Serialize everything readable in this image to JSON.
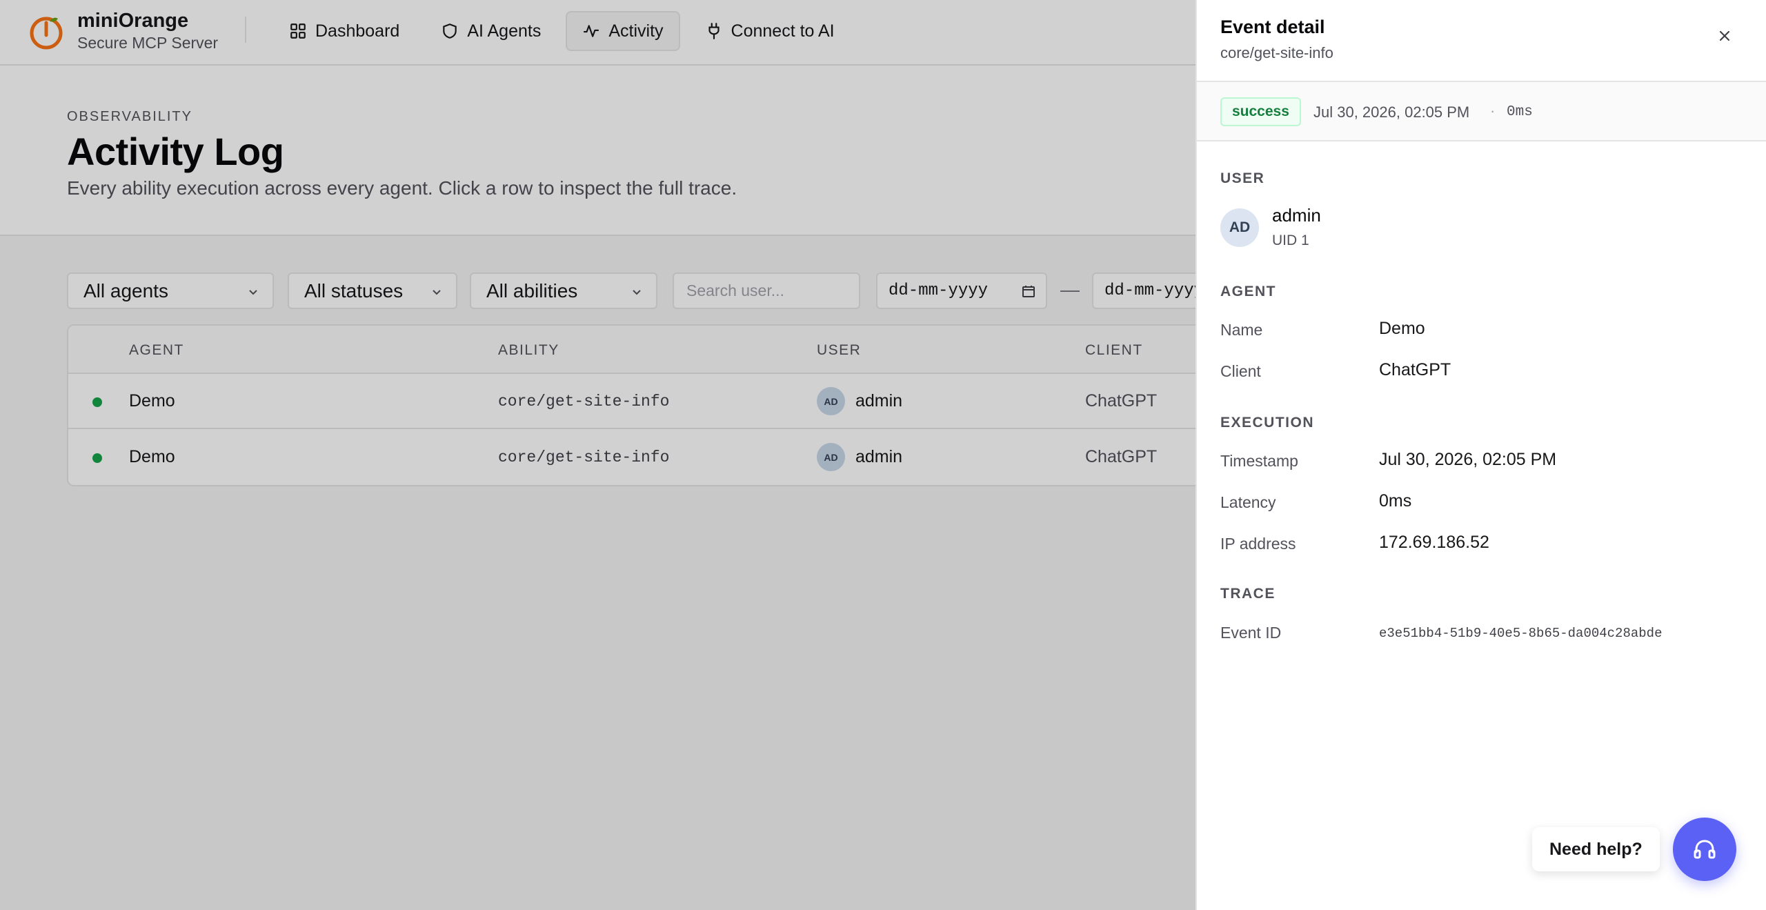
{
  "brand": {
    "name": "miniOrange",
    "subtitle": "Secure MCP Server"
  },
  "nav": {
    "dashboard": "Dashboard",
    "agents": "AI Agents",
    "activity": "Activity",
    "connect": "Connect to AI"
  },
  "header": {
    "eyebrow": "OBSERVABILITY",
    "title": "Activity Log",
    "description": "Every ability execution across every agent. Click a row to inspect the full trace."
  },
  "filters": {
    "agents": "All agents",
    "statuses": "All statuses",
    "abilities": "All abilities",
    "search_placeholder": "Search user...",
    "date_from": "dd-mm-yyyy",
    "separator": "—",
    "date_to": "dd-mm-yyyy"
  },
  "table": {
    "columns": {
      "agent": "AGENT",
      "ability": "ABILITY",
      "user": "USER",
      "client": "CLIENT"
    },
    "rows": [
      {
        "status": "success",
        "agent": "Demo",
        "ability": "core/get-site-info",
        "user_initials": "AD",
        "user": "admin",
        "client": "ChatGPT"
      },
      {
        "status": "success",
        "agent": "Demo",
        "ability": "core/get-site-info",
        "user_initials": "AD",
        "user": "admin",
        "client": "ChatGPT"
      }
    ]
  },
  "drawer": {
    "title": "Event detail",
    "subtitle": "core/get-site-info",
    "status": "success",
    "timestamp": "Jul 30, 2026, 02:05 PM",
    "dot": "·",
    "latency": "0ms",
    "user_section": "USER",
    "user_initials": "AD",
    "user_name": "admin",
    "user_uid": "UID 1",
    "agent_section": "AGENT",
    "name_label": "Name",
    "name_value": "Demo",
    "client_label": "Client",
    "client_value": "ChatGPT",
    "execution_section": "EXECUTION",
    "timestamp_label": "Timestamp",
    "timestamp_value": "Jul 30, 2026, 02:05 PM",
    "latency_label": "Latency",
    "latency_value": "0ms",
    "ip_label": "IP address",
    "ip_value": "172.69.186.52",
    "trace_section": "TRACE",
    "event_id_label": "Event ID",
    "event_id_value": "e3e51bb4-51b9-40e5-8b65-da004c28abde"
  },
  "help": {
    "label": "Need help?"
  },
  "colors": {
    "accent": "#5b61f5",
    "success": "#16a34a",
    "brand_orange": "#f97316"
  }
}
